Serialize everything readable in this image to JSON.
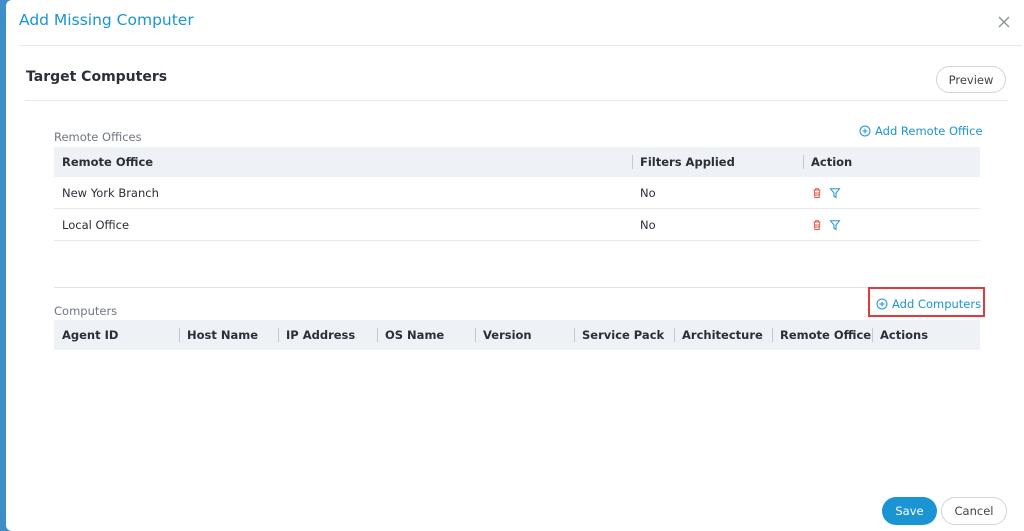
{
  "dialog": {
    "title": "Add Missing Computer",
    "close_icon": "close-icon"
  },
  "target": {
    "title": "Target Computers",
    "preview_label": "Preview"
  },
  "remote_offices": {
    "label": "Remote Offices",
    "add_label": "Add Remote Office",
    "columns": [
      "Remote Office",
      "Filters Applied",
      "Action"
    ],
    "rows": [
      {
        "name": "New York Branch",
        "filters": "No"
      },
      {
        "name": "Local Office",
        "filters": "No"
      }
    ]
  },
  "computers": {
    "label": "Computers",
    "add_label": "Add Computers",
    "columns": [
      "Agent ID",
      "Host Name",
      "IP Address",
      "OS Name",
      "Version",
      "Service Pack",
      "Architecture",
      "Remote Office",
      "Actions"
    ]
  },
  "footer": {
    "save_label": "Save",
    "cancel_label": "Cancel"
  },
  "colors": {
    "accent": "#1b94d4",
    "delete_icon": "#e25b4e",
    "highlight": "#e23a3a"
  }
}
